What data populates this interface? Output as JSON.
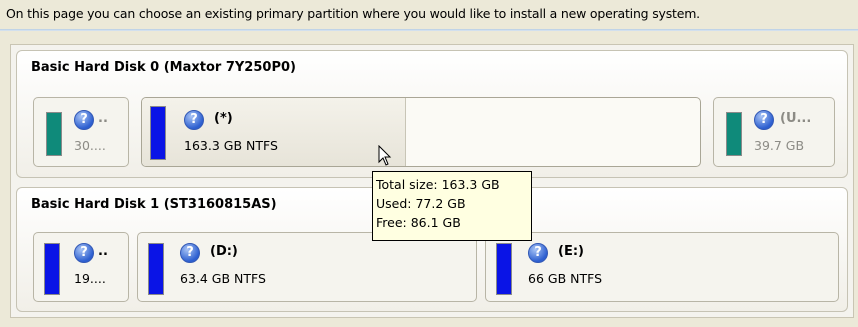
{
  "intro": "On this page you can choose an existing primary partition where you would like to install a new operating system.",
  "disks": [
    {
      "title": "Basic Hard Disk 0 (Maxtor 7Y250P0)",
      "partitions": [
        {
          "label": "..",
          "size": "30....",
          "color": "#0f8a7a"
        },
        {
          "label": "(*)",
          "size": "163.3 GB NTFS",
          "color": "#0a14e6"
        },
        {
          "label": "(U...",
          "size": "39.7 GB",
          "color": "#0f8a7a"
        }
      ]
    },
    {
      "title": "Basic Hard Disk 1 (ST3160815AS)",
      "partitions": [
        {
          "label": "..",
          "size": "19....",
          "color": "#0a14e6"
        },
        {
          "label": "(D:)",
          "size": "63.4 GB NTFS",
          "color": "#0a14e6"
        },
        {
          "label": "(E:)",
          "size": "66 GB NTFS",
          "color": "#0a14e6"
        }
      ]
    }
  ],
  "tooltip": {
    "total": "Total size: 163.3 GB",
    "used": "Used: 77.2 GB",
    "free": "Free: 86.1 GB"
  },
  "icons": {
    "help": "help-icon",
    "cursor": "arrow-cursor-icon"
  }
}
